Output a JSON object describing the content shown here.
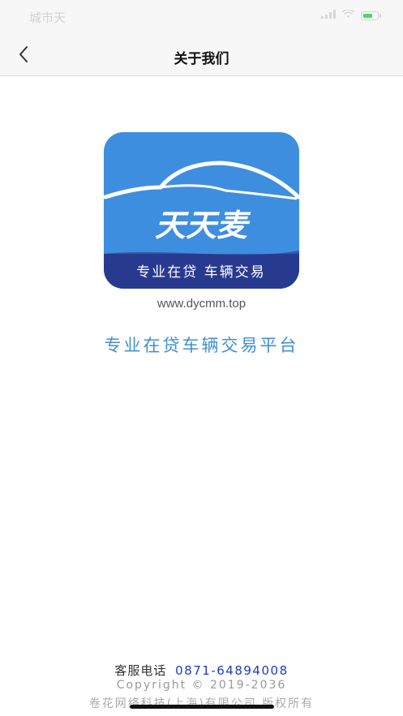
{
  "status_bar": {
    "carrier": "城市天",
    "battery_level_percent": 70,
    "battery_color": "#4cd964"
  },
  "nav": {
    "back_icon": "chevron-left-icon",
    "title": "关于我们"
  },
  "logo": {
    "brand_name": "天天麦",
    "slogan": "专业在贷 车辆交易",
    "colors": {
      "top": "#3e8ee0",
      "bottom": "#283a8f"
    }
  },
  "url": "www.dycmm.top",
  "tagline": "专业在贷车辆交易平台",
  "footer": {
    "phone_label": "客服电话",
    "phone_number": "0871-64894008",
    "copyright": "Copyright © 2019-2036",
    "company": "卷花网络科技(上海)有限公司 版权所有"
  }
}
